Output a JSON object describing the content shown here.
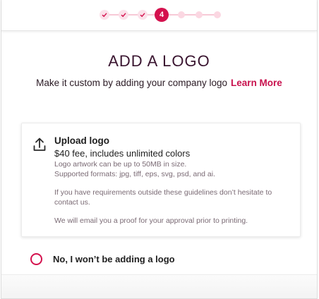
{
  "stepper": {
    "current_step": "4",
    "completed_steps": 3,
    "remaining_steps": 3,
    "colors": {
      "active": "#d4124e",
      "done": "#fbe1ea",
      "todo": "#fbd7e2"
    }
  },
  "header": {
    "title": "ADD A LOGO",
    "subtitle": "Make it custom by adding your company logo",
    "learn_more": "Learn More"
  },
  "upload_option": {
    "icon": "upload-icon",
    "title": "Upload logo",
    "fee": "$40 fee, includes unlimited colors",
    "size_note": "Logo artwork can be up to 50MB in size.",
    "formats_note": "Supported formats: jpg, tiff, eps, svg, psd, and ai.",
    "requirements_note": "If you have requirements outside these guidelines don’t hesitate to contact us.",
    "proof_note": "We will email you a proof for your approval prior to printing."
  },
  "no_logo_option": {
    "label": "No, I won’t be adding a logo",
    "selected": false
  },
  "accent_color": "#d4124e"
}
